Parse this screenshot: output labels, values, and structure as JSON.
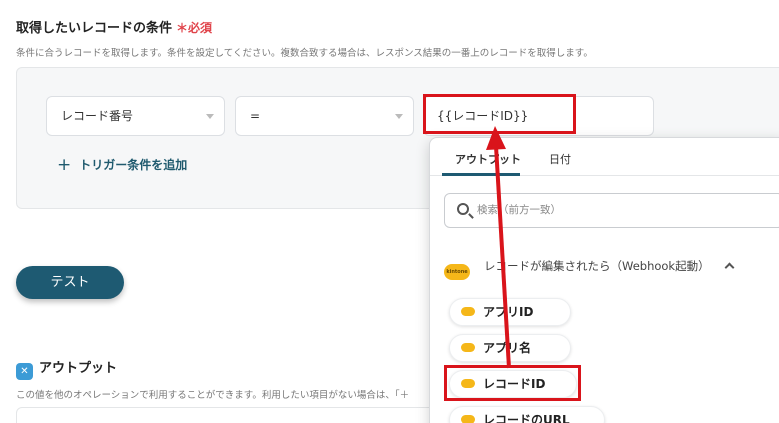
{
  "condition": {
    "title": "取得したいレコードの条件",
    "required_mark": "＊必須",
    "description": "条件に合うレコードを取得します。条件を設定してください。複数合致する場合は、レスポンス結果の一番上のレコードを取得します。",
    "field_select": "レコード番号",
    "operator_select": "=",
    "value": "{{レコードID}}",
    "add_trigger_label": "トリガー条件を追加",
    "add_trigger_plus": "+"
  },
  "test_button": "テスト",
  "output": {
    "title": "アウトプット",
    "icon": "output-icon",
    "description": "この値を他のオペレーションで利用することができます。利用したい項目がない場合は、「＋"
  },
  "dropdown": {
    "tabs": [
      "アウトプット",
      "日付"
    ],
    "search_placeholder": "検索（前方一致）",
    "group_title": "レコードが編集されたら（Webhook起動）",
    "logo_text": "kintone",
    "items": [
      "アプリID",
      "アプリ名",
      "レコードID",
      "レコードのURL"
    ]
  },
  "colors": {
    "accent": "#1e5a72",
    "highlight": "#d9141b",
    "required": "#e0444b",
    "kintone": "#f5b719"
  }
}
